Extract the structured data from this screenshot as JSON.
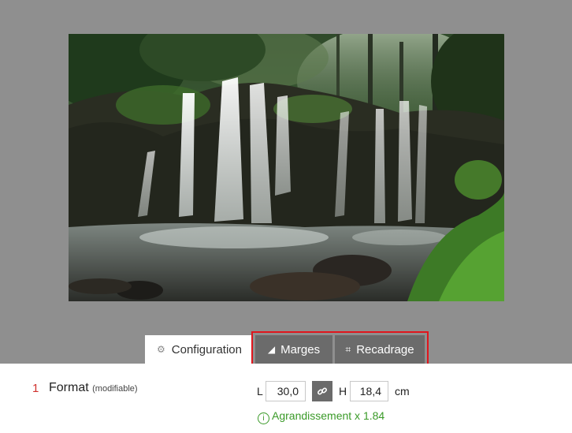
{
  "tabs": {
    "configuration": "Configuration",
    "marges": "Marges",
    "recadrage": "Recadrage"
  },
  "step": {
    "number": "1",
    "title": "Format",
    "subtitle": "(modifiable)"
  },
  "dimensions": {
    "width_label": "L",
    "width_value": "30,0",
    "height_label": "H",
    "height_value": "18,4",
    "unit": "cm"
  },
  "enlargement": {
    "icon": "info-circle-icon",
    "text": "Agrandissement x 1.84"
  },
  "colors": {
    "highlight": "#e0151c",
    "dark_tab": "#6b6b6b",
    "note": "#3a9a28",
    "step_number": "#d0312d"
  }
}
